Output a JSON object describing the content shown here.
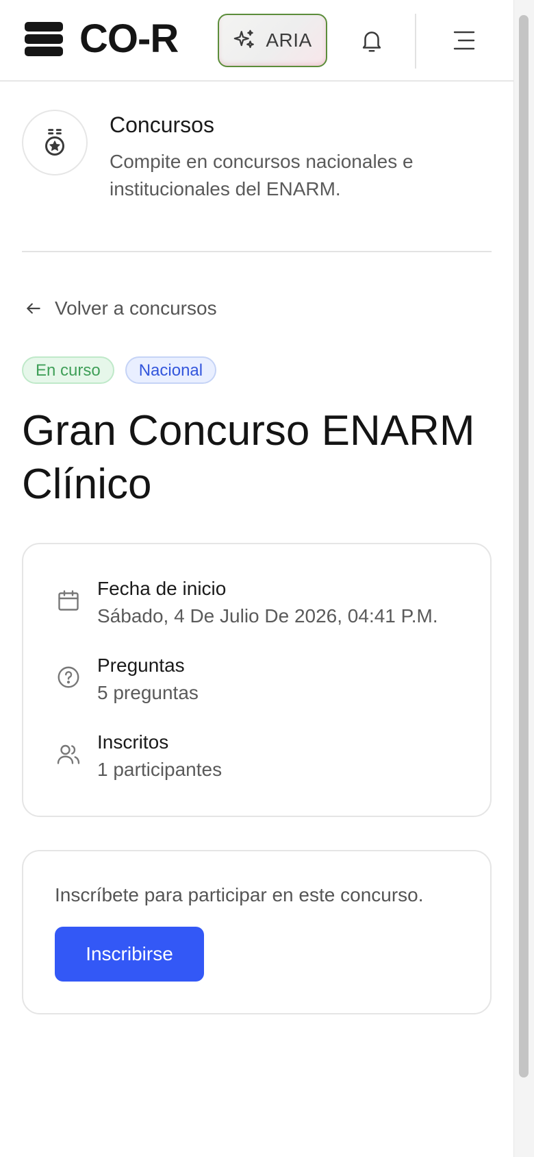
{
  "header": {
    "logo_text": "CO-R",
    "aria_label": "ARIA"
  },
  "section": {
    "title": "Concursos",
    "description": "Compite en concursos nacionales e institucionales del ENARM."
  },
  "back_link": "Volver a concursos",
  "badges": [
    {
      "label": "En curso",
      "color": "#3f9f58"
    },
    {
      "label": "Nacional",
      "color": "#3356dc"
    }
  ],
  "contest": {
    "title": "Gran Concurso ENARM Clínico",
    "details": [
      {
        "icon": "calendar-icon",
        "label": "Fecha de inicio",
        "value": "Sábado, 4 De Julio De 2026, 04:41 P.M."
      },
      {
        "icon": "question-circle-icon",
        "label": "Preguntas",
        "value": "5 preguntas"
      },
      {
        "icon": "users-icon",
        "label": "Inscritos",
        "value": "1 participantes"
      }
    ]
  },
  "register": {
    "message": "Inscríbete para participar en este concurso.",
    "button_label": "Inscribirse",
    "button_color": "#3358f6"
  }
}
